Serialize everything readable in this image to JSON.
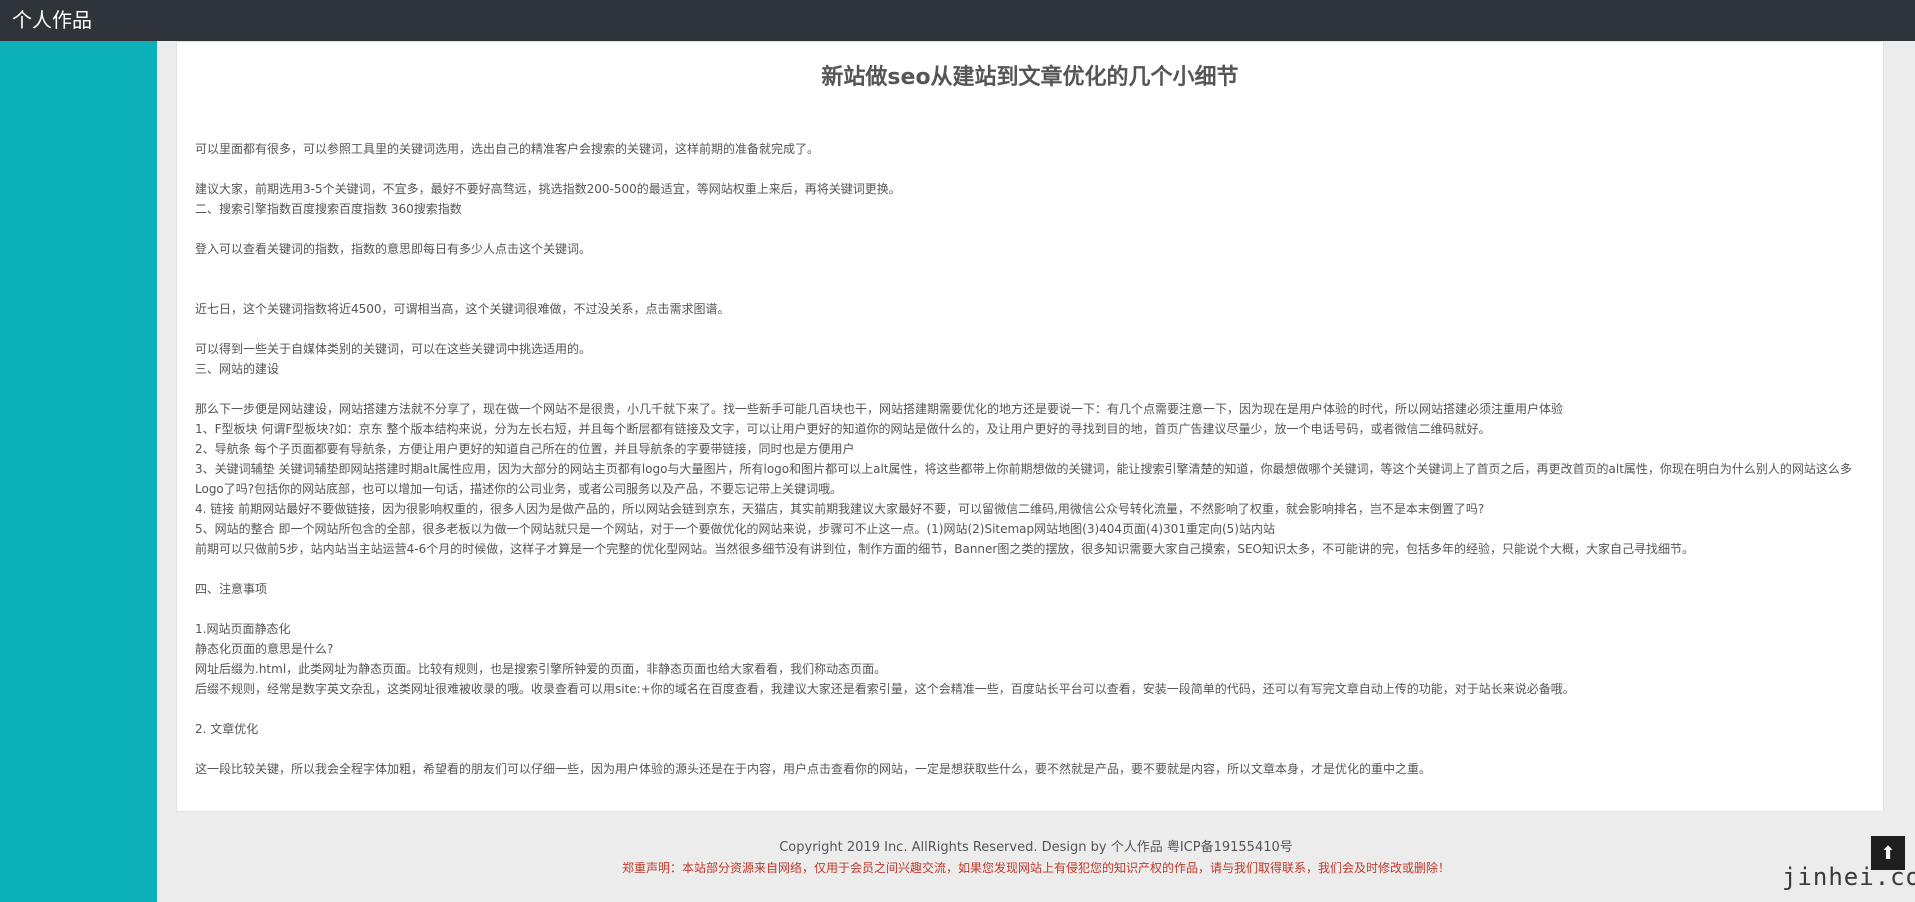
{
  "header": {
    "site_title": "个人作品"
  },
  "article": {
    "title": "新站做seo从建站到文章优化的几个小细节",
    "paragraphs": [
      "可以里面都有很多，可以参照工具里的关键词选用，选出自己的精准客户会搜索的关键词，这样前期的准备就完成了。",
      "",
      "建议大家，前期选用3-5个关键词，不宜多，最好不要好高骛远，挑选指数200-500的最适宜，等网站权重上来后，再将关键词更换。",
      "二、搜索引擎指数百度搜索百度指数 360搜索指数",
      "",
      "登入可以查看关键词的指数，指数的意思即每日有多少人点击这个关键词。",
      "",
      "",
      "近七日，这个关键词指数将近4500，可谓相当高，这个关键词很难做，不过没关系，点击需求图谱。",
      "",
      "可以得到一些关于自媒体类别的关键词，可以在这些关键词中挑选适用的。",
      "三、网站的建设",
      "",
      "那么下一步便是网站建设，网站搭建方法就不分享了，现在做一个网站不是很贵，小几千就下来了。找一些新手可能几百块也干，网站搭建期需要优化的地方还是要说一下：有几个点需要注意一下，因为现在是用户体验的时代，所以网站搭建必须注重用户体验",
      "1、F型板块 何谓F型板块?如：京东 整个版本结构来说，分为左长右短，并且每个断层都有链接及文字，可以让用户更好的知道你的网站是做什么的，及让用户更好的寻找到目的地，首页广告建议尽量少，放一个电话号码，或者微信二维码就好。",
      "2、导航条 每个子页面都要有导航条，方便让用户更好的知道自己所在的位置，并且导航条的字要带链接，同时也是方便用户",
      "3、关键词辅垫 关键词辅垫即网站搭建时期alt属性应用，因为大部分的网站主页都有logo与大量图片，所有logo和图片都可以上alt属性，将这些都带上你前期想做的关键词，能让搜索引擎清楚的知道，你最想做哪个关键词，等这个关键词上了首页之后，再更改首页的alt属性，你现在明白为什么别人的网站这么多Logo了吗?包括你的网站底部，也可以增加一句话，描述你的公司业务，或者公司服务以及产品，不要忘记带上关键词哦。",
      "4. 链接 前期网站最好不要做链接，因为很影响权重的，很多人因为是做产品的，所以网站会链到京东，天猫店，其实前期我建议大家最好不要，可以留微信二维码,用微信公众号转化流量，不然影响了权重，就会影响排名，岂不是本末倒置了吗?",
      "5、网站的整合 即一个网站所包含的全部，很多老板以为做一个网站就只是一个网站，对于一个要做优化的网站来说，步骤可不止这一点。(1)网站(2)Sitemap网站地图(3)404页面(4)301重定向(5)站内站",
      "前期可以只做前5步，站内站当主站运营4-6个月的时候做，这样子才算是一个完整的优化型网站。当然很多细节没有讲到位，制作方面的细节，Banner图之类的摆放，很多知识需要大家自己摸索，SEO知识太多，不可能讲的完，包括多年的经验，只能说个大概，大家自己寻找细节。",
      "",
      "四、注意事项",
      "",
      "1.网站页面静态化",
      "静态化页面的意思是什么?",
      "网址后缀为.html，此类网址为静态页面。比较有规则，也是搜索引擎所钟爱的页面，非静态页面也给大家看看，我们称动态页面。",
      "后缀不规则，经常是数字英文杂乱，这类网址很难被收录的哦。收录查看可以用site:+你的域名在百度查看，我建议大家还是看索引量，这个会精准一些，百度站长平台可以查看，安装一段简单的代码，还可以有写完文章自动上传的功能，对于站长来说必备哦。",
      "",
      "2. 文章优化",
      "",
      "这一段比较关键，所以我会全程字体加粗，希望看的朋友们可以仔细一些，因为用户体验的源头还是在于内容，用户点击查看你的网站，一定是想获取些什么，要不然就是产品，要不要就是内容，所以文章本身，才是优化的重中之重。"
    ]
  },
  "footer": {
    "copyright": "Copyright 2019 Inc. AllRights Reserved. Design by 个人作品 粤ICP备19155410号",
    "disclaimer": "郑重声明：本站部分资源来自网络，仅用于会员之间兴趣交流，如果您发现网站上有侵犯您的知识产权的作品，请与我们取得联系，我们会及时修改或删除！"
  },
  "back_to_top": {
    "icon": "arrow-up-icon",
    "glyph": "⬆"
  },
  "watermark": {
    "text": "jinhei.com"
  },
  "colors": {
    "topbar": "#2f333a",
    "sidebar": "#0bb0b8",
    "disclaimer": "#c0392b"
  }
}
